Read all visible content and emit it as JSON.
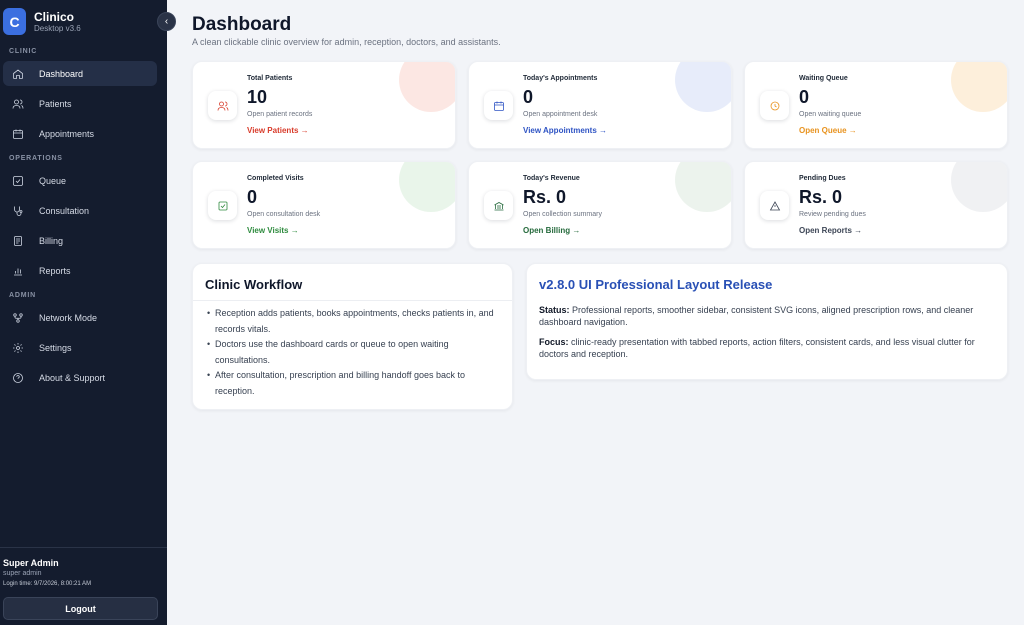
{
  "app": {
    "name": "Clinico",
    "version": "Desktop v3.6",
    "logo_letter": "C"
  },
  "sidebar": {
    "sections": {
      "clinic": "CLINIC",
      "operations": "OPERATIONS",
      "admin": "ADMIN"
    },
    "items": [
      {
        "label": "Dashboard",
        "icon": "home-icon",
        "active": true
      },
      {
        "label": "Patients",
        "icon": "users-icon"
      },
      {
        "label": "Appointments",
        "icon": "calendar-icon"
      },
      {
        "label": "Queue",
        "icon": "checkbox-icon"
      },
      {
        "label": "Consultation",
        "icon": "stethoscope-icon"
      },
      {
        "label": "Billing",
        "icon": "document-icon"
      },
      {
        "label": "Reports",
        "icon": "bar-chart-icon"
      },
      {
        "label": "Network Mode",
        "icon": "network-icon"
      },
      {
        "label": "Settings",
        "icon": "gear-icon"
      },
      {
        "label": "About & Support",
        "icon": "help-icon"
      }
    ],
    "collapse_glyph": "‹"
  },
  "user": {
    "name": "Super Admin",
    "role": "super admin",
    "login_time": "Login time: 9/7/2026, 8:00:21 AM",
    "logout_label": "Logout"
  },
  "header": {
    "title": "Dashboard",
    "subtitle": "A clean clickable clinic overview for admin, reception, doctors, and assistants."
  },
  "cards": [
    {
      "label": "Total Patients",
      "value": "10",
      "desc": "Open patient records",
      "link": "View Patients →",
      "accent": "#d83b2a",
      "blob": "#f9c9c2",
      "icon": "users-icon"
    },
    {
      "label": "Today's Appointments",
      "value": "0",
      "desc": "Open appointment desk",
      "link": "View Appointments →",
      "accent": "#2f54c4",
      "blob": "#c9d4f5",
      "icon": "calendar-icon"
    },
    {
      "label": "Waiting Queue",
      "value": "0",
      "desc": "Open waiting queue",
      "link": "Open Queue →",
      "accent": "#e8921d",
      "blob": "#fbdcb0",
      "icon": "clock-icon"
    },
    {
      "label": "Completed Visits",
      "value": "0",
      "desc": "Open consultation desk",
      "link": "View Visits →",
      "accent": "#2e8b3e",
      "blob": "#cfe9d0",
      "icon": "check-square-icon"
    },
    {
      "label": "Today's Revenue",
      "value": "Rs. 0",
      "desc": "Open collection summary",
      "link": "Open Billing →",
      "accent": "#256a3c",
      "blob": "#d5e4d8",
      "icon": "bank-icon"
    },
    {
      "label": "Pending Dues",
      "value": "Rs. 0",
      "desc": "Review pending dues",
      "link": "Open Reports →",
      "accent": "#3d4656",
      "blob": "#dde0e5",
      "icon": "warning-icon"
    }
  ],
  "workflow": {
    "title": "Clinic Workflow",
    "items": [
      "Reception adds patients, books appointments, checks patients in, and records vitals.",
      "Doctors use the dashboard cards or queue to open waiting consultations.",
      "After consultation, prescription and billing handoff goes back to reception."
    ]
  },
  "release": {
    "title": "v2.8.0 UI Professional Layout Release",
    "status_label": "Status:",
    "status_text": "Professional reports, smoother sidebar, consistent SVG icons, aligned prescription rows, and cleaner dashboard navigation.",
    "focus_label": "Focus:",
    "focus_text": "clinic-ready presentation with tabbed reports, action filters, consistent cards, and less visual clutter for doctors and reception."
  }
}
